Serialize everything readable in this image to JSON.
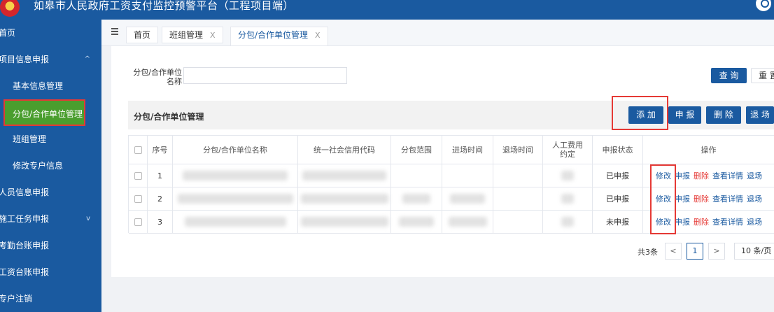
{
  "header": {
    "title": "如皋市人民政府工资支付监控预警平台（工程项目端）"
  },
  "sidebar": {
    "items": [
      {
        "label": "首页",
        "sub": false
      },
      {
        "label": "项目信息申报",
        "sub": false,
        "arrow": "^"
      },
      {
        "label": "基本信息管理",
        "sub": true
      },
      {
        "label": "分包/合作单位管理",
        "sub": true,
        "active": true
      },
      {
        "label": "班组管理",
        "sub": true
      },
      {
        "label": "修改专户信息",
        "sub": true
      },
      {
        "label": "人员信息申报",
        "sub": false
      },
      {
        "label": "施工任务申报",
        "sub": false,
        "arrow": "v"
      },
      {
        "label": "考勤台账申报",
        "sub": false
      },
      {
        "label": "工资台账申报",
        "sub": false
      },
      {
        "label": "专户注销",
        "sub": false
      }
    ]
  },
  "tabs": [
    {
      "label": "首页"
    },
    {
      "label": "班组管理",
      "close": "X"
    },
    {
      "label": "分包/合作单位管理",
      "close": "X"
    }
  ],
  "filter": {
    "label": "分包/合作单位名称",
    "value": ""
  },
  "buttons": {
    "query": "查 询",
    "reset": "重 置",
    "add": "添 加",
    "declare": "申 报",
    "delete": "删 除",
    "exit": "退 场"
  },
  "section": {
    "title": "分包/合作单位管理"
  },
  "table": {
    "headers": [
      "序号",
      "分包/合作单位名称",
      "统一社会信用代码",
      "分包范围",
      "进场时间",
      "退场时间",
      "人工费用约定",
      "申报状态",
      "操作"
    ],
    "rows": [
      {
        "no": "1",
        "status": "已申报"
      },
      {
        "no": "2",
        "status": "已申报"
      },
      {
        "no": "3",
        "status": "未申报"
      }
    ],
    "actions": {
      "edit": "修改",
      "declare": "申报",
      "delete": "删除",
      "detail": "查看详情",
      "exit": "退场"
    }
  },
  "pagination": {
    "total": "共3条",
    "prev": "<",
    "page": "1",
    "next": ">",
    "size": "10 条/页"
  }
}
